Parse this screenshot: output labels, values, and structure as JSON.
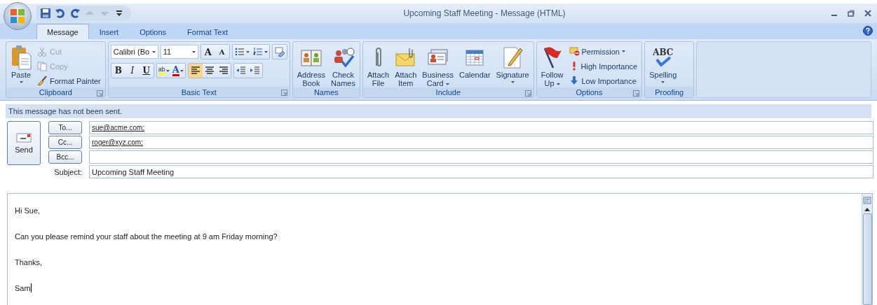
{
  "quick_access": [
    {
      "kind": "save",
      "disabled": false
    },
    {
      "kind": "undo",
      "disabled": false
    },
    {
      "kind": "redo",
      "disabled": false
    },
    {
      "kind": "up",
      "disabled": true
    },
    {
      "kind": "down",
      "disabled": true
    },
    {
      "kind": "customize",
      "disabled": false
    }
  ],
  "window": {
    "title": "Upcoming Staff Meeting - Message (HTML)"
  },
  "tabs": [
    {
      "label": "Message",
      "selected": true
    },
    {
      "label": "Insert",
      "selected": false
    },
    {
      "label": "Options",
      "selected": false
    },
    {
      "label": "Format Text",
      "selected": false
    }
  ],
  "ribbon": {
    "groups": [
      {
        "name": "Clipboard",
        "launcher": true,
        "items": [
          {
            "kind": "paste",
            "label": "Paste",
            "dropdown": true
          },
          {
            "kind": "stack",
            "items": [
              {
                "kind": "cut",
                "label": "Cut",
                "disabled": true,
                "dropdown": false
              },
              {
                "kind": "copy",
                "label": "Copy",
                "disabled": true,
                "dropdown": false
              },
              {
                "kind": "brush",
                "label": "Format Painter",
                "disabled": false,
                "dropdown": false
              }
            ]
          }
        ]
      },
      {
        "name": "Basic Text",
        "launcher": true,
        "items": [
          {
            "kind": "font",
            "font": "Calibri (Bo",
            "size": "11",
            "row1": [
              {
                "kind": "grow",
                "glyph": "A"
              },
              {
                "kind": "shrink",
                "glyph": "A"
              },
              {
                "kind": "bullets"
              },
              {
                "kind": "numbering"
              },
              {
                "kind": "clear"
              }
            ],
            "row2": [
              {
                "kind": "bold",
                "glyph": "B"
              },
              {
                "kind": "italic",
                "glyph": "I"
              },
              {
                "kind": "underline",
                "glyph": "U"
              },
              {
                "kind": "highlight",
                "glyph": "ab"
              },
              {
                "kind": "color",
                "glyph": "A"
              },
              {
                "kind": "align-left",
                "selected": true
              },
              {
                "kind": "align-center",
                "selected": false
              },
              {
                "kind": "align-right",
                "selected": false
              },
              {
                "kind": "outdent"
              },
              {
                "kind": "indent"
              }
            ]
          }
        ]
      },
      {
        "name": "Names",
        "launcher": false,
        "items": [
          {
            "kind": "book",
            "label": "Address\nBook",
            "dropdown": false
          },
          {
            "kind": "people",
            "label": "Check\nNames",
            "dropdown": false
          }
        ]
      },
      {
        "name": "Include",
        "launcher": true,
        "items": [
          {
            "kind": "clip",
            "label": "Attach\nFile",
            "dropdown": false
          },
          {
            "kind": "envelope",
            "label": "Attach\nItem",
            "dropdown": false
          },
          {
            "kind": "card",
            "label": "Business\nCard",
            "dropdown": true
          },
          {
            "kind": "calendar",
            "label": "Calendar",
            "dropdown": false
          },
          {
            "kind": "pen",
            "label": "Signature",
            "dropdown": true
          }
        ]
      },
      {
        "name": "Options",
        "launcher": true,
        "items": [
          {
            "kind": "flag",
            "label": "Follow\nUp",
            "dropdown": true
          },
          {
            "kind": "stack",
            "items": [
              {
                "kind": "permission",
                "label": "Permission",
                "disabled": false,
                "dropdown": true
              },
              {
                "kind": "high",
                "label": "High Importance",
                "disabled": false,
                "dropdown": false
              },
              {
                "kind": "low",
                "label": "Low Importance",
                "disabled": false,
                "dropdown": false
              }
            ]
          }
        ]
      },
      {
        "name": "Proofing",
        "launcher": false,
        "items": [
          {
            "kind": "spell",
            "glyph": "ABC",
            "label": "Spelling",
            "dropdown": true
          }
        ]
      }
    ]
  },
  "infobar": "This message has not been sent.",
  "send_button": "Send",
  "recipients": [
    {
      "button": "To...",
      "value": "sue@acme.com;"
    },
    {
      "button": "Cc...",
      "value": "roger@xyz.com;"
    },
    {
      "button": "Bcc..."
    }
  ],
  "subject": {
    "label": "Subject:",
    "value": "Upcoming Staff Meeting"
  },
  "body": {
    "paragraphs": [
      "Hi Sue,",
      "Can you please remind your staff about the meeting at 9 am Friday morning?",
      "Thanks,",
      "Sam"
    ]
  }
}
